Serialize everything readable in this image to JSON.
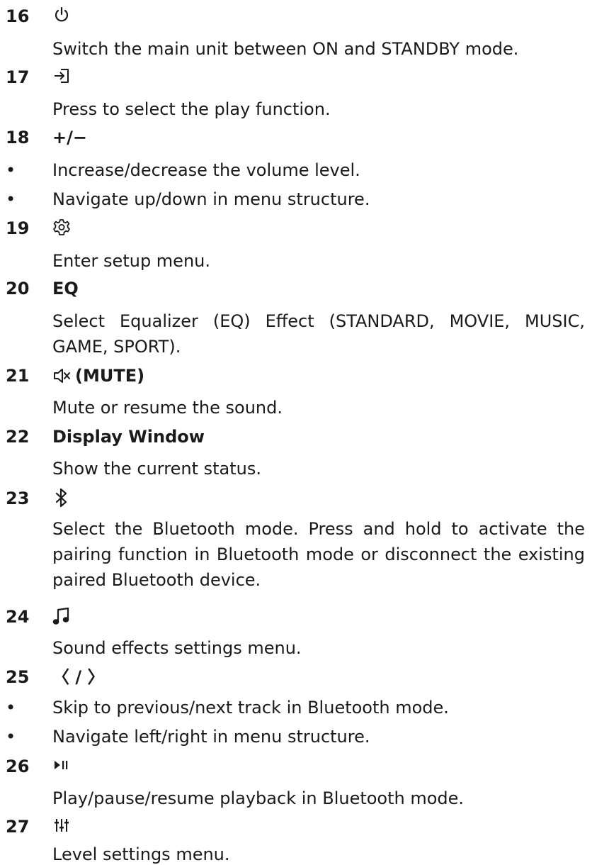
{
  "items": [
    {
      "number": "16",
      "icon": "power-icon",
      "title": "",
      "description": "Switch the main unit between ON and STANDBY mode."
    },
    {
      "number": "17",
      "icon": "input-source-icon",
      "title": "",
      "description": "Press to select the play function."
    },
    {
      "number": "18",
      "icon": "",
      "title": "+/−",
      "bullets": [
        "Increase/decrease the volume level.",
        "Navigate up/down in menu structure."
      ]
    },
    {
      "number": "19",
      "icon": "gear-icon",
      "title": "",
      "description": "Enter setup menu."
    },
    {
      "number": "20",
      "icon": "",
      "title": "EQ",
      "description": "Select Equalizer (EQ) Effect (STANDARD, MOVIE, MUSIC, GAME, SPORT)."
    },
    {
      "number": "21",
      "icon": "mute-icon",
      "title": "(MUTE)",
      "description": "Mute or resume the sound."
    },
    {
      "number": "22",
      "icon": "",
      "title": "Display Window",
      "description": "Show the current status."
    },
    {
      "number": "23",
      "icon": "bluetooth-icon",
      "title": "",
      "description": "Select the Bluetooth mode. Press and hold to activate the pairing function in Bluetooth mode or disconnect the existing paired Bluetooth device."
    },
    {
      "number": "24",
      "icon": "music-note-icon",
      "title": "",
      "description": "Sound effects settings menu."
    },
    {
      "number": "25",
      "icon": "",
      "title": "〈 / 〉",
      "bullets": [
        "Skip to previous/next track in Bluetooth mode.",
        "Navigate left/right in menu structure."
      ]
    },
    {
      "number": "26",
      "icon": "play-pause-icon",
      "title": "",
      "description": "Play/pause/resume playback in Bluetooth mode."
    },
    {
      "number": "27",
      "icon": "level-sliders-icon",
      "title": "",
      "description": "Level settings menu."
    }
  ],
  "bullet_glyph": "•"
}
